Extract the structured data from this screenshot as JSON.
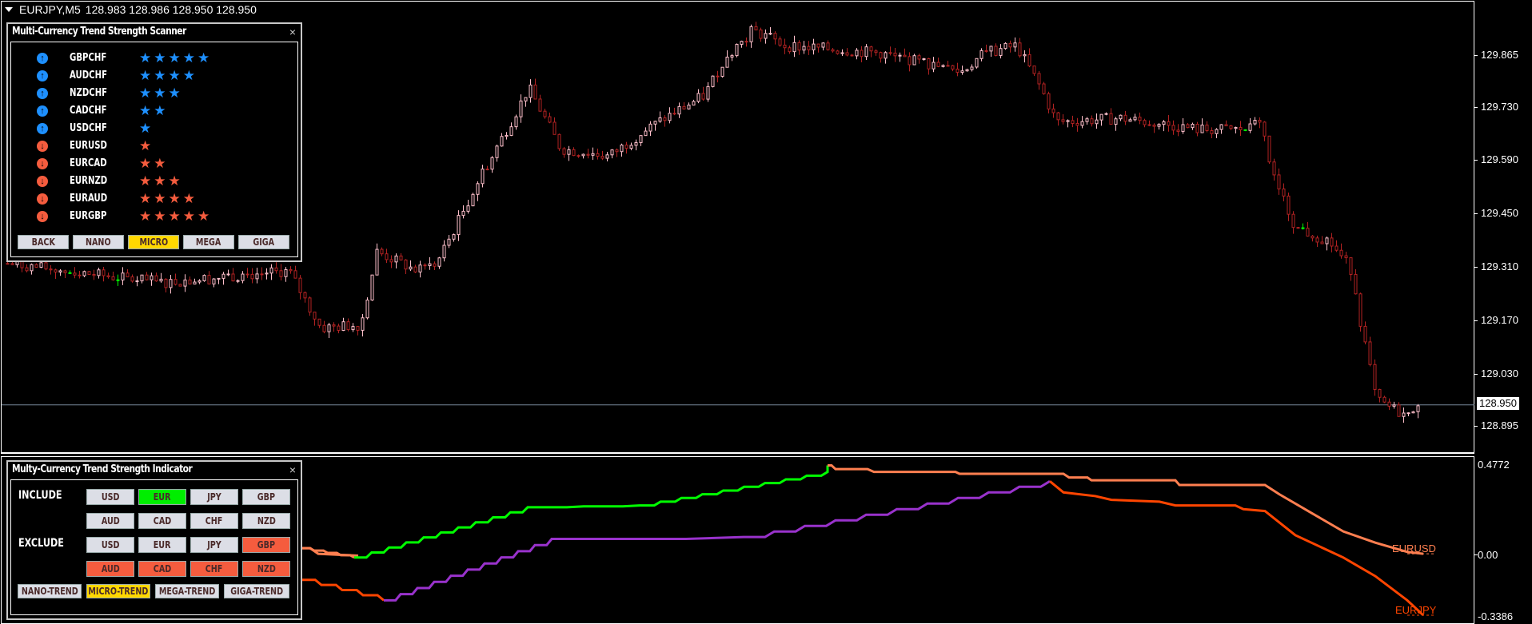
{
  "symbol_bar": {
    "symbol": "EURJPY,M5",
    "ohlc": "128.983 128.986 128.950 128.950"
  },
  "price_axis": {
    "labels": [
      "129.865",
      "129.730",
      "129.590",
      "129.450",
      "129.310",
      "129.170",
      "129.030",
      "128.895"
    ],
    "current_price": "128.950"
  },
  "indicator_axis": {
    "labels": [
      "0.4772",
      "0.00",
      "-0.3386"
    ]
  },
  "colors": {
    "bull_candle": "#ffc0cb",
    "bear_candle": "#b22222",
    "doji": "#00ff00",
    "up_blue": "#1e90ff",
    "down_red": "#f55c3e",
    "eur_line": "#00ff00",
    "jpy_line": "#9932cc",
    "eurusd_line": "#ff7f50",
    "eurjpy_line": "#ff4500",
    "button_active": "#ffd800"
  },
  "scanner": {
    "title": "Multi-Currency Trend Strength Scanner",
    "close": "×",
    "rows": [
      {
        "pair": "GBPCHF",
        "direction": "up",
        "stars": "★★★★★"
      },
      {
        "pair": "AUDCHF",
        "direction": "up",
        "stars": "★★★★"
      },
      {
        "pair": "NZDCHF",
        "direction": "up",
        "stars": "★★★"
      },
      {
        "pair": "CADCHF",
        "direction": "up",
        "stars": "★★"
      },
      {
        "pair": "USDCHF",
        "direction": "up",
        "stars": "★"
      },
      {
        "pair": "EURUSD",
        "direction": "down",
        "stars": "★"
      },
      {
        "pair": "EURCAD",
        "direction": "down",
        "stars": "★★"
      },
      {
        "pair": "EURNZD",
        "direction": "down",
        "stars": "★★★"
      },
      {
        "pair": "EURAUD",
        "direction": "down",
        "stars": "★★★★"
      },
      {
        "pair": "EURGBP",
        "direction": "down",
        "stars": "★★★★★"
      }
    ],
    "buttons": [
      {
        "label": "BACK",
        "active": false
      },
      {
        "label": "NANO",
        "active": false
      },
      {
        "label": "MICRO",
        "active": true
      },
      {
        "label": "MEGA",
        "active": false
      },
      {
        "label": "GIGA",
        "active": false
      }
    ]
  },
  "indicator": {
    "title": "Multy-Currency Trend Strength Indicator",
    "close": "×",
    "include_label": "INCLUDE",
    "exclude_label": "EXCLUDE",
    "include": [
      {
        "label": "USD",
        "state": "off"
      },
      {
        "label": "EUR",
        "state": "on"
      },
      {
        "label": "JPY",
        "state": "off"
      },
      {
        "label": "GBP",
        "state": "off"
      },
      {
        "label": "AUD",
        "state": "off"
      },
      {
        "label": "CAD",
        "state": "off"
      },
      {
        "label": "CHF",
        "state": "off"
      },
      {
        "label": "NZD",
        "state": "off"
      }
    ],
    "exclude": [
      {
        "label": "USD",
        "state": "off"
      },
      {
        "label": "EUR",
        "state": "off"
      },
      {
        "label": "JPY",
        "state": "off"
      },
      {
        "label": "GBP",
        "state": "on"
      },
      {
        "label": "AUD",
        "state": "on"
      },
      {
        "label": "CAD",
        "state": "on"
      },
      {
        "label": "CHF",
        "state": "on"
      },
      {
        "label": "NZD",
        "state": "on"
      }
    ],
    "trend_buttons": [
      {
        "label": "NANO-TREND",
        "active": false
      },
      {
        "label": "MICRO-TREND",
        "active": true
      },
      {
        "label": "MEGA-TREND",
        "active": false
      },
      {
        "label": "GIGA-TREND",
        "active": false
      }
    ],
    "line_labels": {
      "eurusd": "EURUSD",
      "eurjpy": "EURJPY"
    }
  }
}
